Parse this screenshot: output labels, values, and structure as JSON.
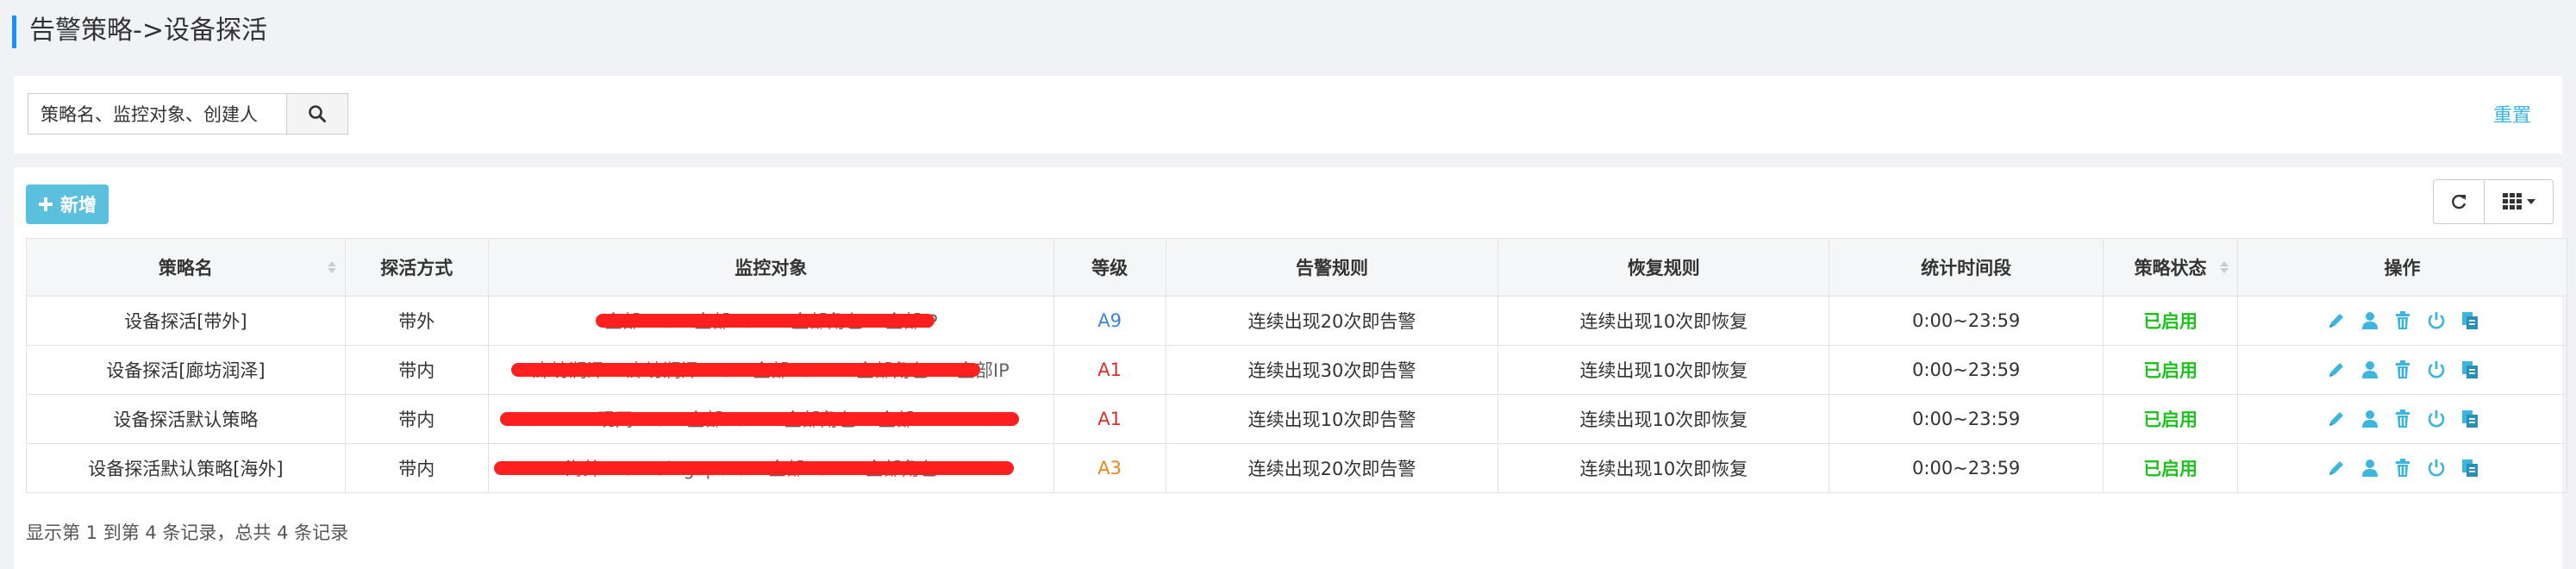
{
  "page": {
    "title": "告警策略->设备探活"
  },
  "search": {
    "placeholder": "策略名、监控对象、创建人等",
    "value": "策略名、监控对象、创建人",
    "reset_label": "重置"
  },
  "toolbar": {
    "add_label": "新增"
  },
  "table": {
    "columns": [
      "策略名",
      "探活方式",
      "监控对象",
      "等级",
      "告警规则",
      "恢复规则",
      "统计时间段",
      "策略状态",
      "操作"
    ],
    "rows": [
      {
        "name": "设备探活[带外]",
        "method": "带外",
        "target": "全部IDC->全部POD->全部角色->全部IP",
        "level": "A9",
        "level_color": "#3a86d8",
        "alert_rule": "连续出现20次即告警",
        "recover_rule": "连续出现10次即恢复",
        "period": "0:00~23:59",
        "status": "已启用"
      },
      {
        "name": "设备探活[廊坊润泽]",
        "method": "带内",
        "target": "廊坊润泽->廊坊润泽IDC->全部POD-->全部角色-->全部IP",
        "level": "A1",
        "level_color": "#d9302c",
        "alert_rule": "连续出现30次即告警",
        "recover_rule": "连续出现10次即恢复",
        "period": "0:00~23:59",
        "status": "已启用"
      },
      {
        "name": "设备探活默认策略",
        "method": "带内",
        "target": "现网IDC->全部POD->全部角色->全部IP...",
        "level": "A1",
        "level_color": "#d9302c",
        "alert_rule": "连续出现10次即告警",
        "recover_rule": "连续出现10次即恢复",
        "period": "0:00~23:59",
        "status": "已启用"
      },
      {
        "name": "设备探活默认策略[海外]",
        "method": "带内",
        "target": "海外IDC->Singapore->全部POD->全部角色->...",
        "level": "A3",
        "level_color": "#e8861a",
        "alert_rule": "连续出现20次即告警",
        "recover_rule": "连续出现10次即恢复",
        "period": "0:00~23:59",
        "status": "已启用"
      }
    ]
  },
  "footer": {
    "summary": "显示第 1 到第 4 条记录，总共 4 条记录"
  },
  "colors": {
    "accent": "#3db5de",
    "status_enabled": "#1fc11f",
    "redaction": "#ff1f1f"
  }
}
